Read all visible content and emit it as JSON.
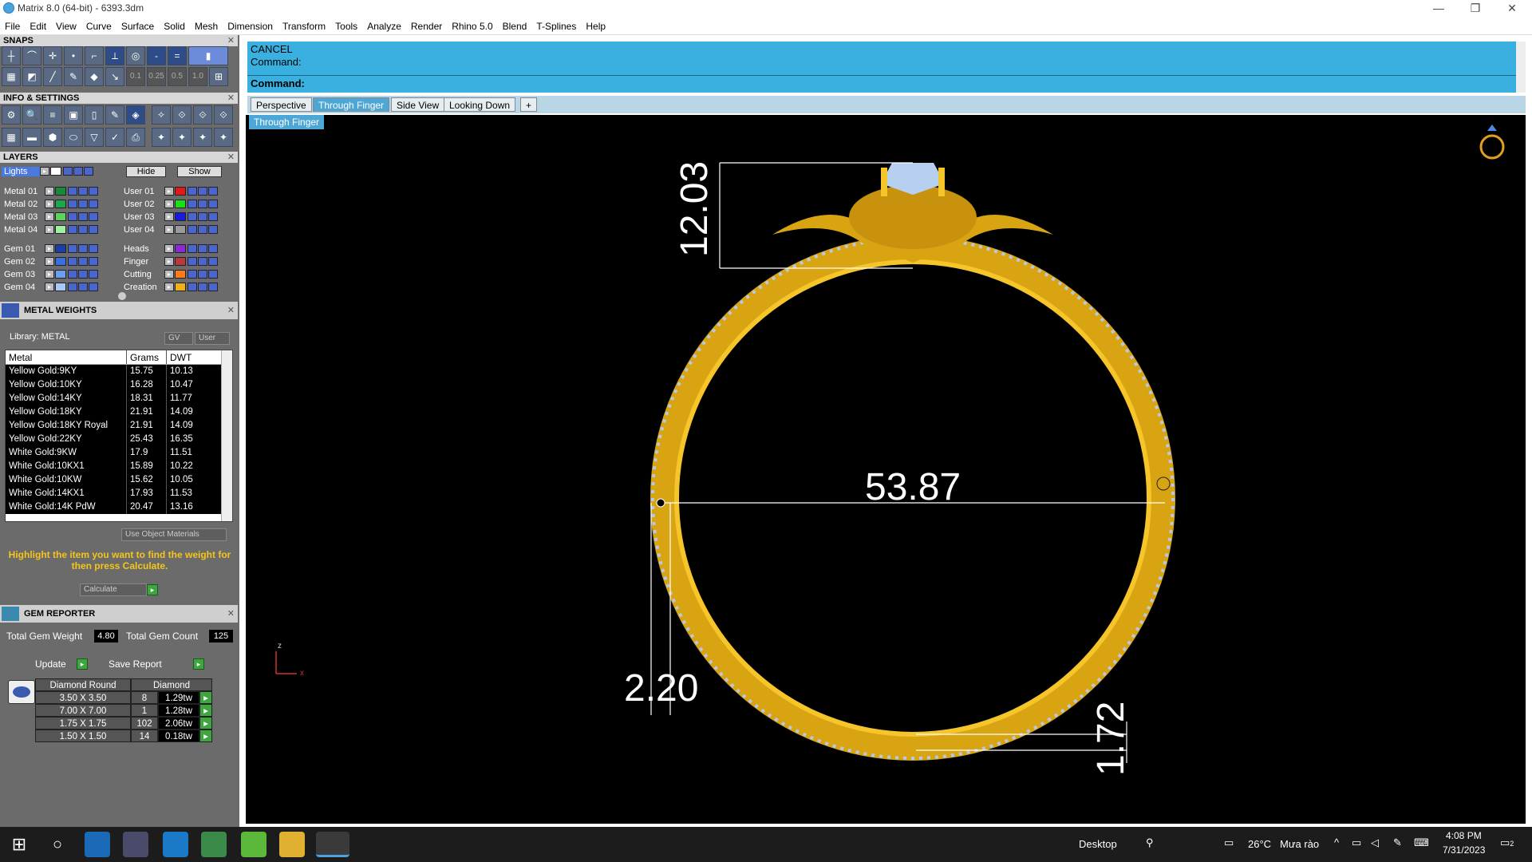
{
  "window": {
    "title": "Matrix 8.0 (64-bit) - 6393.3dm",
    "minimize": "—",
    "maximize": "❐",
    "close": "✕"
  },
  "menu": [
    "File",
    "Edit",
    "View",
    "Curve",
    "Surface",
    "Solid",
    "Mesh",
    "Dimension",
    "Transform",
    "Tools",
    "Analyze",
    "Render",
    "Rhino 5.0",
    "Blend",
    "T-Splines",
    "Help"
  ],
  "snaps": {
    "title": "SNAPS",
    "values": [
      "0.1",
      "0.25",
      "0.5",
      "1.0"
    ]
  },
  "info": {
    "title": "INFO & SETTINGS"
  },
  "layers": {
    "title": "LAYERS",
    "lights": "Lights",
    "hide": "Hide",
    "show": "Show",
    "left": [
      {
        "name": "Metal 01",
        "color": "#1a8a3a"
      },
      {
        "name": "Metal 02",
        "color": "#1ea64a"
      },
      {
        "name": "Metal 03",
        "color": "#5fd15f"
      },
      {
        "name": "Metal 04",
        "color": "#9ff09f"
      },
      {
        "name": "Gem 01",
        "color": "#1a3fa6"
      },
      {
        "name": "Gem 02",
        "color": "#3a6fe0"
      },
      {
        "name": "Gem 03",
        "color": "#6a9ff0"
      },
      {
        "name": "Gem 04",
        "color": "#a8c8f8"
      }
    ],
    "right": [
      {
        "name": "User 01",
        "color": "#e01a1a"
      },
      {
        "name": "User 02",
        "color": "#1ae01a"
      },
      {
        "name": "User 03",
        "color": "#1a1ae0"
      },
      {
        "name": "User 04",
        "color": "#9a9a9a"
      },
      {
        "name": "Heads",
        "color": "#8a2ad0"
      },
      {
        "name": "Finger",
        "color": "#b83a3a"
      },
      {
        "name": "Cutting",
        "color": "#ff7a1a"
      },
      {
        "name": "Creation",
        "color": "#f0b01a"
      }
    ]
  },
  "metal_weights": {
    "title": "METAL WEIGHTS",
    "library": "Library: METAL",
    "gv": "GV",
    "user": "User",
    "columns": [
      "Metal",
      "Grams",
      "DWT"
    ],
    "rows": [
      [
        "Yellow Gold:9KY",
        "15.75",
        "10.13"
      ],
      [
        "Yellow Gold:10KY",
        "16.28",
        "10.47"
      ],
      [
        "Yellow Gold:14KY",
        "18.31",
        "11.77"
      ],
      [
        "Yellow Gold:18KY",
        "21.91",
        "14.09"
      ],
      [
        "Yellow Gold:18KY Royal",
        "21.91",
        "14.09"
      ],
      [
        "Yellow Gold:22KY",
        "25.43",
        "16.35"
      ],
      [
        "White Gold:9KW",
        "17.9",
        "11.51"
      ],
      [
        "White Gold:10KX1",
        "15.89",
        "10.22"
      ],
      [
        "White Gold:10KW",
        "15.62",
        "10.05"
      ],
      [
        "White Gold:14KX1",
        "17.93",
        "11.53"
      ],
      [
        "White Gold:14K PdW",
        "20.47",
        "13.16"
      ]
    ],
    "use_object_materials": "Use Object Materials",
    "hint": "Highlight the item you want to find the weight for then press Calculate.",
    "calculate": "Calculate"
  },
  "gem_reporter": {
    "title": "GEM REPORTER",
    "total_weight_label": "Total Gem Weight",
    "total_weight": "4.80",
    "total_count_label": "Total Gem Count",
    "total_count": "125",
    "update": "Update",
    "save_report": "Save Report",
    "header": [
      "Diamond Round",
      "Diamond"
    ],
    "rows": [
      [
        "3.50 X 3.50",
        "8",
        "1.29tw"
      ],
      [
        "7.00 X 7.00",
        "1",
        "1.28tw"
      ],
      [
        "1.75 X 1.75",
        "102",
        "2.06tw"
      ],
      [
        "1.50 X 1.50",
        "14",
        "0.18tw"
      ]
    ]
  },
  "command": {
    "line1": "CANCEL",
    "line2": "Command:",
    "prompt": "Command:"
  },
  "tabs": [
    "Perspective",
    "Through Finger",
    "Side View",
    "Looking Down",
    "+"
  ],
  "viewport": {
    "label": "Through Finger",
    "dims": {
      "height": "12.03",
      "diameter": "53.87",
      "thickness": "2.20",
      "bottom": "1.72"
    },
    "axis_z": "z",
    "axis_x": "x"
  },
  "taskbar": {
    "desktop": "Desktop",
    "weather_temp": "26°C",
    "weather_desc": "Mưa rào",
    "time": "4:08 PM",
    "date": "7/31/2023",
    "notif": "2"
  }
}
